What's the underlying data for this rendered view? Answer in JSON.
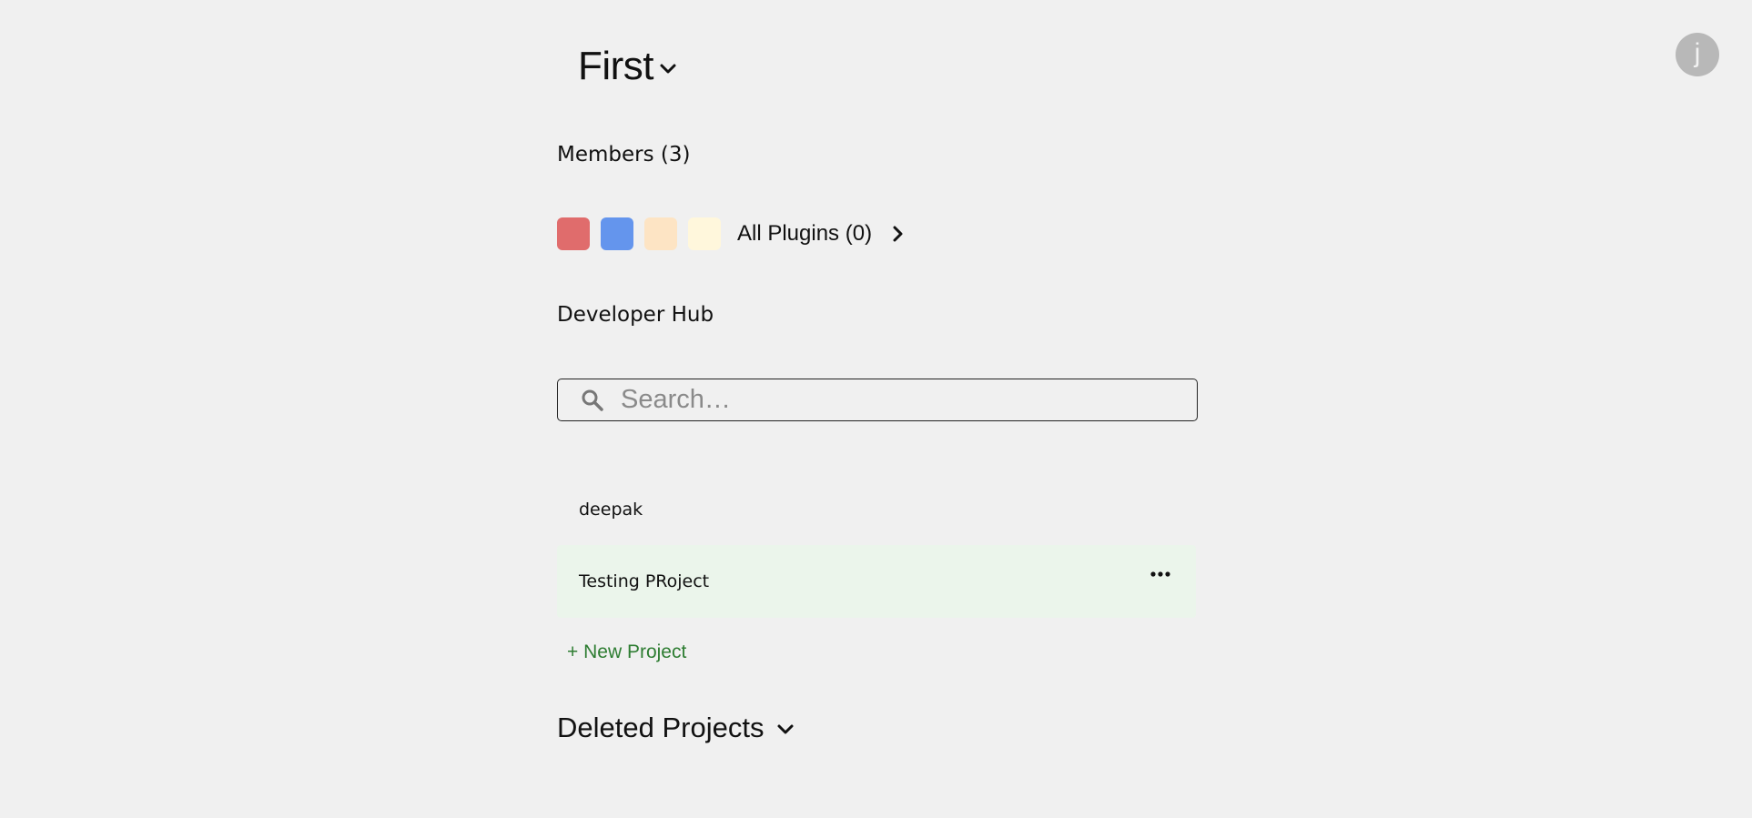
{
  "header": {
    "workspace_title": "First",
    "avatar_initial": "j"
  },
  "members": {
    "label": "Members (3)"
  },
  "plugins": {
    "swatch_colors": [
      "#e06c6c",
      "#6495ed",
      "#fde4c4",
      "#fff7dc"
    ],
    "label": "All Plugins (0)"
  },
  "developer_hub": {
    "heading": "Developer Hub"
  },
  "search": {
    "placeholder": "Search…",
    "value": ""
  },
  "projects": [
    {
      "name": "deepak"
    },
    {
      "name": "Testing PRoject"
    }
  ],
  "new_project_label": "+ New Project",
  "deleted_projects_label": "Deleted Projects",
  "icons": {
    "title_chevron": "chevron-down-icon",
    "plugins_arrow": "chevron-right-icon",
    "search": "search-icon",
    "project_menu": "more-horizontal-icon",
    "deleted_chevron": "chevron-down-icon"
  }
}
